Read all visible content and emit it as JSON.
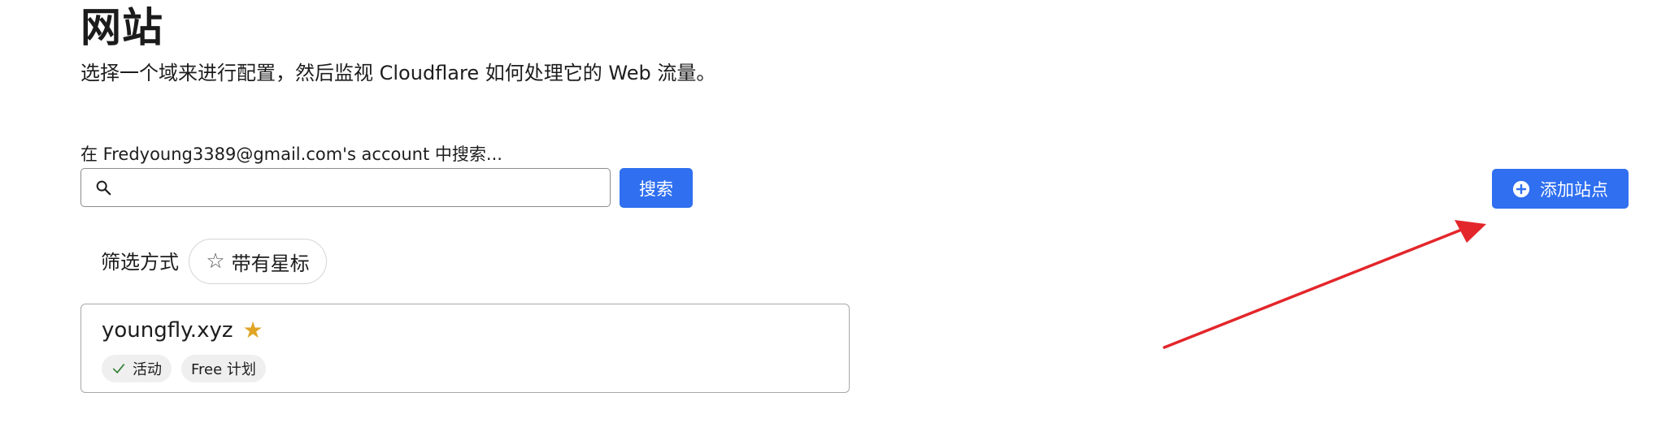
{
  "header": {
    "title": "网站",
    "subtitle": "选择一个域来进行配置，然后监视 Cloudflare 如何处理它的 Web 流量。"
  },
  "search": {
    "label": "在 Fredyoung3389@gmail.com's account 中搜索...",
    "value": "",
    "placeholder": "",
    "button_label": "搜索",
    "icon": "search-icon"
  },
  "add_site": {
    "label": "添加站点",
    "icon": "plus-circle-icon"
  },
  "filter": {
    "label": "筛选方式",
    "chips": [
      {
        "label": "带有星标",
        "icon": "star-outline-icon"
      }
    ]
  },
  "sites": [
    {
      "name": "youngfly.xyz",
      "starred": true,
      "badges": [
        {
          "label": "活动",
          "icon": "check-icon"
        },
        {
          "label": "Free 计划"
        }
      ]
    }
  ],
  "colors": {
    "primary": "#2f6ff0",
    "star": "#e0a526",
    "active_check": "#2e7d32",
    "annotation_arrow": "#e3262b",
    "badge_bg": "#efefef"
  }
}
